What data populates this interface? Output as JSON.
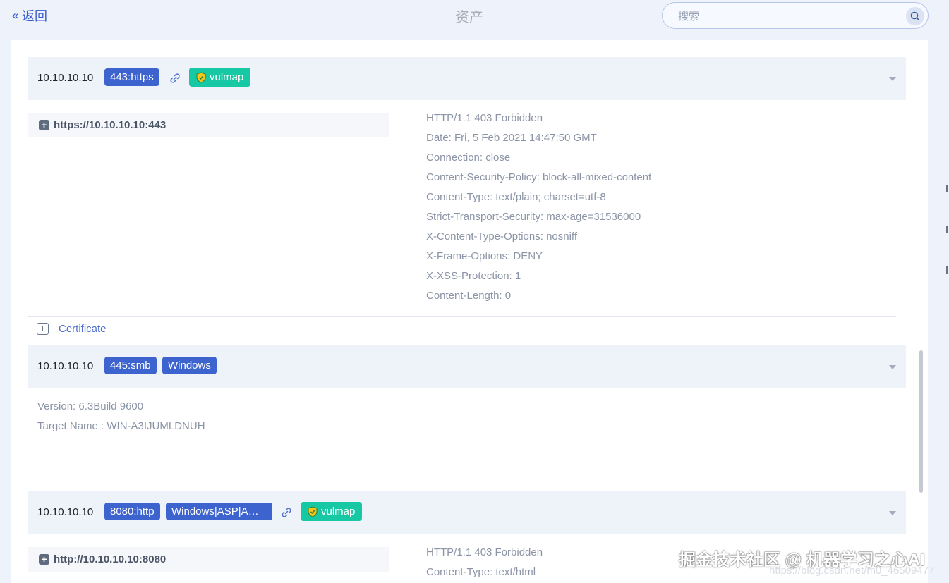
{
  "header": {
    "back_label": "返回",
    "title": "资产",
    "search_placeholder": "搜索"
  },
  "assets": [
    {
      "ip": "10.10.10.10",
      "tags": [
        "443:https"
      ],
      "vuln_label": "vulmap",
      "url": "https://10.10.10.10:443",
      "response": [
        "HTTP/1.1 403 Forbidden",
        "Date: Fri, 5 Feb 2021 14:47:50 GMT",
        "Connection: close",
        "Content-Security-Policy: block-all-mixed-content",
        "Content-Type: text/plain; charset=utf-8",
        "Strict-Transport-Security: max-age=31536000",
        "X-Content-Type-Options: nosniff",
        "X-Frame-Options: DENY",
        "X-XSS-Protection: 1",
        "Content-Length: 0"
      ],
      "certificate_label": "Certificate"
    },
    {
      "ip": "10.10.10.10",
      "tags": [
        "445:smb",
        "Windows"
      ],
      "info": [
        "Version: 6.3Build 9600",
        "Target Name : WIN-A3IJUMLDNUH"
      ]
    },
    {
      "ip": "10.10.10.10",
      "tags": [
        "8080:http",
        "Windows|ASP|A…"
      ],
      "vuln_label": "vulmap",
      "url": "http://10.10.10.10:8080",
      "response": [
        "HTTP/1.1 403 Forbidden",
        "Content-Type: text/html"
      ]
    }
  ],
  "watermark": {
    "text": "掘金技术社区 @ 机器学习之心AI",
    "url": "https://blog.csdn.net/m0_46509477"
  },
  "colors": {
    "accent": "#3d63cf",
    "vuln": "#16c8a4",
    "background": "#eef3fb"
  }
}
